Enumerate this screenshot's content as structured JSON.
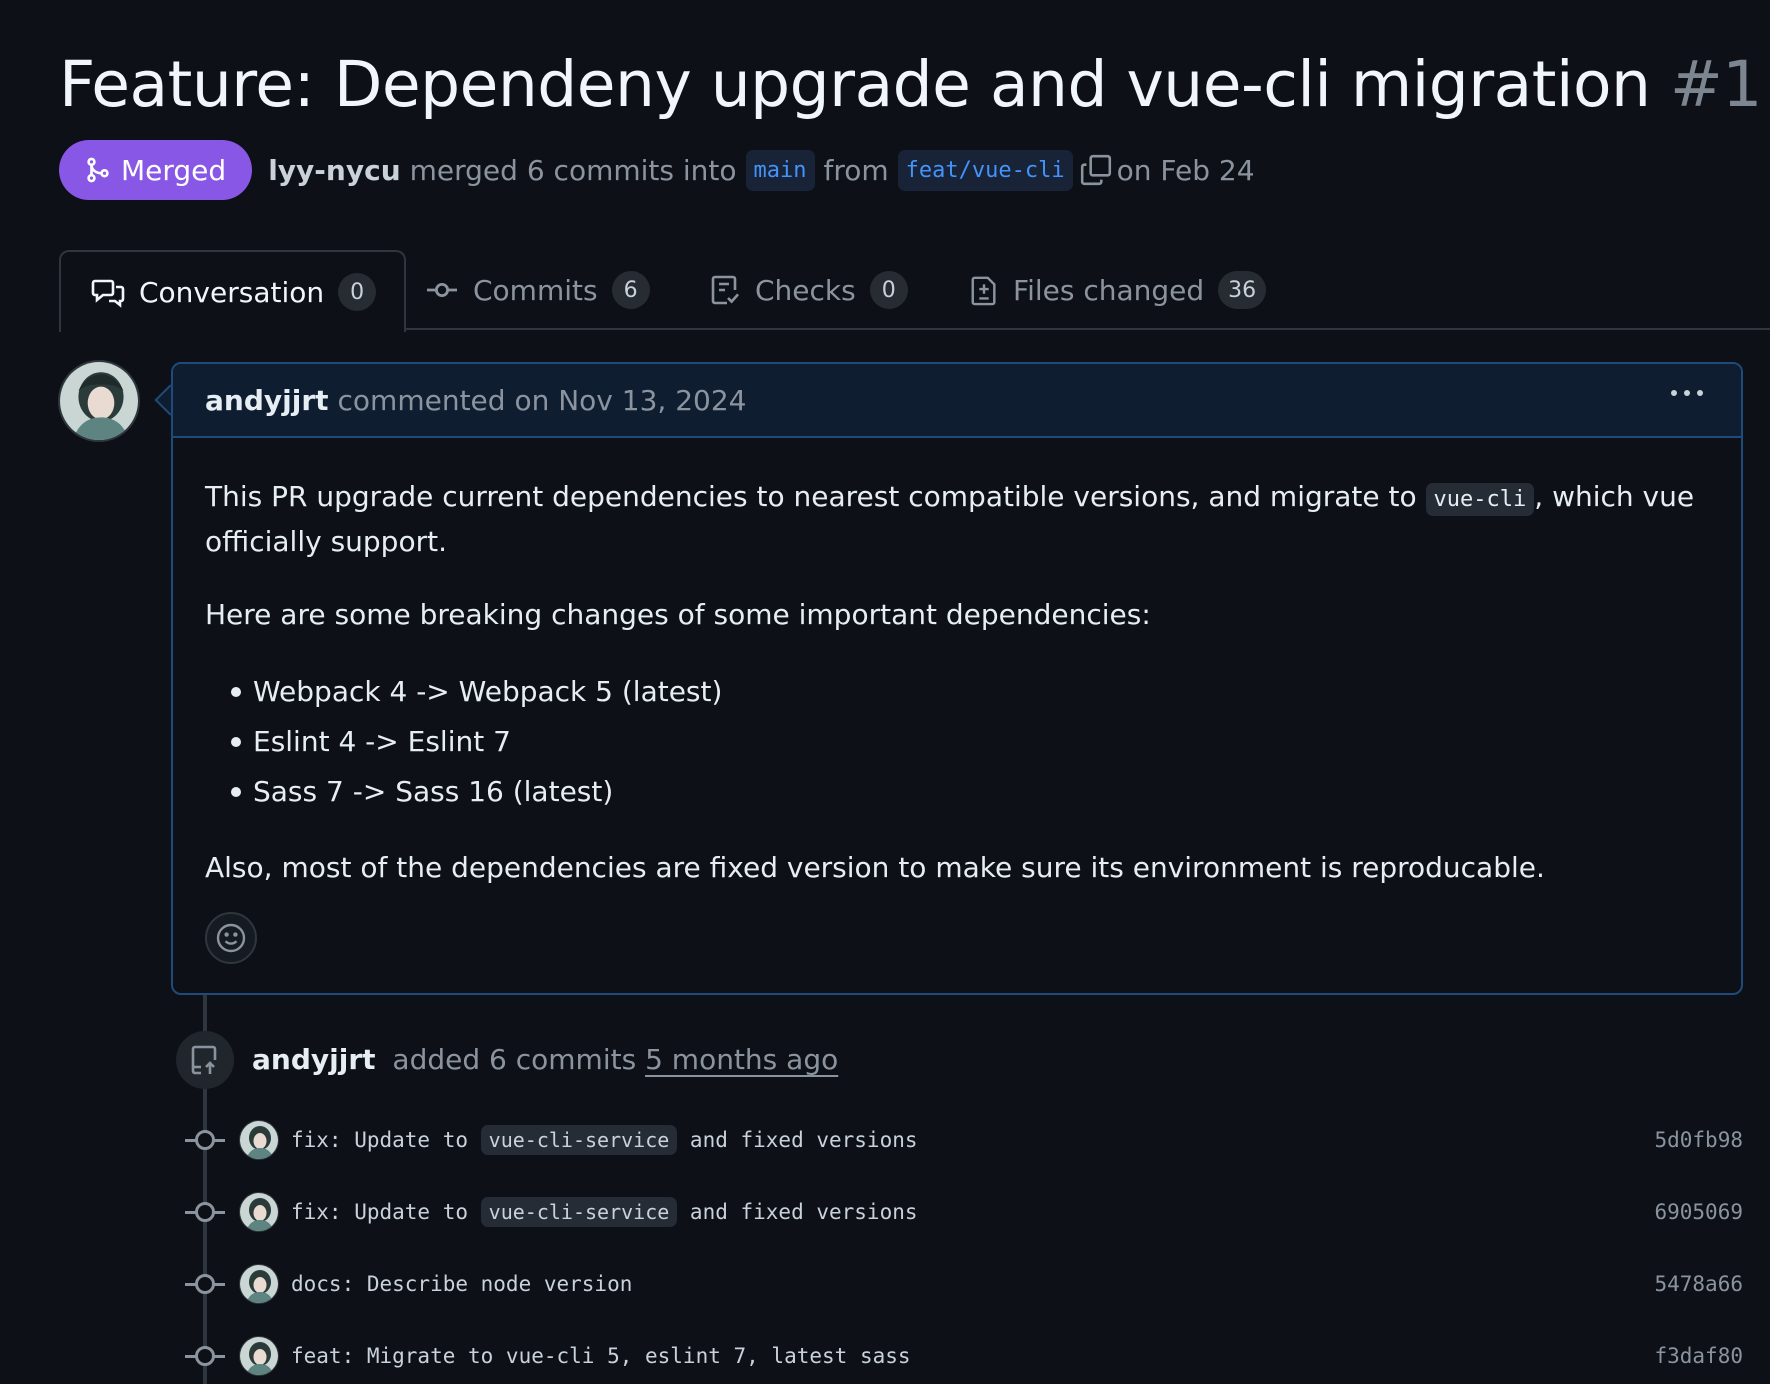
{
  "pr": {
    "title": "Feature: Dependeny upgrade and vue-cli migration",
    "number": "#1",
    "state": "Merged",
    "author": "lyy-nycu",
    "merged_text": "merged 6 commits into",
    "base_branch": "main",
    "from_text": "from",
    "head_branch": "feat/vue-cli",
    "date_text": "on Feb 24"
  },
  "tabs": [
    {
      "label": "Conversation",
      "count": "0",
      "icon": "comment-discussion-icon"
    },
    {
      "label": "Commits",
      "count": "6",
      "icon": "git-commit-icon"
    },
    {
      "label": "Checks",
      "count": "0",
      "icon": "checklist-icon"
    },
    {
      "label": "Files changed",
      "count": "36",
      "icon": "file-diff-icon"
    }
  ],
  "comment": {
    "author": "andyjjrt",
    "meta": "commented on Nov 13, 2024",
    "p1_before": "This PR upgrade current dependencies to nearest compatible versions, and migrate to ",
    "p1_code": "vue-cli",
    "p1_after": ", which vue officially support.",
    "p2": "Here are some breaking changes of some important dependencies:",
    "list": [
      "Webpack 4 -> Webpack 5 (latest)",
      "Eslint 4 -> Eslint 7",
      "Sass 7 -> Sass 16 (latest)"
    ],
    "p3": "Also, most of the dependencies are fixed version to make sure its environment is reproducable."
  },
  "event": {
    "author": "andyjjrt",
    "text": "added 6 commits",
    "ago": "5 months ago"
  },
  "commits": [
    {
      "before": "fix: Update to ",
      "code": "vue-cli-service",
      "after": " and fixed versions",
      "sha": "5d0fb98"
    },
    {
      "before": "fix: Update to ",
      "code": "vue-cli-service",
      "after": " and fixed versions",
      "sha": "6905069"
    },
    {
      "before": "docs: Describe node version",
      "code": "",
      "after": "",
      "sha": "5478a66"
    },
    {
      "before": "feat: Migrate to vue-cli 5, eslint 7, latest sass",
      "code": "",
      "after": "",
      "sha": "f3daf80"
    }
  ],
  "colors": {
    "background": "#0d1117",
    "merged": "#8957e5",
    "link": "#4493f8",
    "border_accent": "#1f4a7c"
  }
}
